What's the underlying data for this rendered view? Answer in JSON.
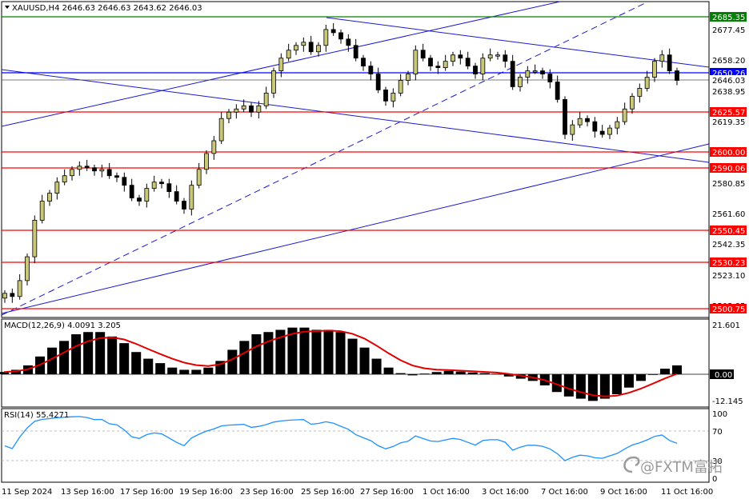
{
  "window": {
    "symbol_header": "XAUUSD,H4  2646.63 2646.63 2643.62 2646.03"
  },
  "colors": {
    "background": "#ffffff",
    "frame": "#000000",
    "bull_candle": "#c8c878",
    "bear_candle": "#000000",
    "support_line": "#ff0000",
    "resistance_line": "#008000",
    "trend_line": "#0000cc",
    "bid_line": "#0000ff",
    "macd_signal": "#e00000",
    "rsi_line": "#1e90ff",
    "watermark": "#9a9a9a"
  },
  "price_axis": {
    "ticks": [
      "2677.45",
      "2658.20",
      "2638.95",
      "2619.35",
      "2580.85",
      "2561.60",
      "2542.35",
      "2523.10",
      "2503.85"
    ],
    "tagged_levels": [
      {
        "value": "2685.35",
        "kind": "resistance"
      },
      {
        "value": "2650.26",
        "kind": "bid"
      },
      {
        "value": "2646.03",
        "kind": "last"
      },
      {
        "value": "2625.57",
        "kind": "support"
      },
      {
        "value": "2600.00",
        "kind": "support"
      },
      {
        "value": "2590.06",
        "kind": "support"
      },
      {
        "value": "2550.45",
        "kind": "support"
      },
      {
        "value": "2530.23",
        "kind": "support"
      },
      {
        "value": "2500.75",
        "kind": "support"
      }
    ]
  },
  "macd": {
    "label": "MACD(12,26,9) 4.0091 3.205",
    "axis_ticks": [
      "21.601",
      "0.00",
      "-12.145"
    ]
  },
  "rsi": {
    "label": "RSI(14) 55.4271",
    "axis_ticks": [
      "100",
      "70",
      "30",
      "0"
    ]
  },
  "time_axis": {
    "labels": [
      "11 Sep 2024",
      "13 Sep 16:00",
      "17 Sep 16:00",
      "19 Sep 16:00",
      "23 Sep 16:00",
      "25 Sep 16:00",
      "27 Sep 16:00",
      "1 Oct 16:00",
      "3 Oct 16:00",
      "7 Oct 16:00",
      "9 Oct 16:00",
      "11 Oct 16:00"
    ]
  },
  "watermark": {
    "text": "@FXTM富拓",
    "icon": "fxtm-swirl-icon"
  },
  "chart_data": {
    "type": "candlestick",
    "symbol": "XAUUSD",
    "timeframe": "H4",
    "last_ohlc": {
      "open": 2646.63,
      "high": 2646.63,
      "low": 2643.62,
      "close": 2646.03
    },
    "ylim": [
      2500,
      2700
    ],
    "horizontal_levels": [
      2685.35,
      2650.26,
      2646.03,
      2625.57,
      2600.0,
      2590.06,
      2550.45,
      2530.23,
      2500.75
    ],
    "close_path": [
      2512,
      2510,
      2520,
      2535,
      2558,
      2570,
      2575,
      2582,
      2586,
      2590,
      2592,
      2591,
      2589,
      2590,
      2586,
      2585,
      2580,
      2572,
      2570,
      2578,
      2582,
      2581,
      2576,
      2570,
      2565,
      2580,
      2590,
      2600,
      2608,
      2622,
      2626,
      2628,
      2630,
      2626,
      2630,
      2638,
      2652,
      2660,
      2665,
      2668,
      2670,
      2664,
      2668,
      2678,
      2676,
      2672,
      2668,
      2660,
      2655,
      2650,
      2640,
      2633,
      2638,
      2646,
      2650,
      2665,
      2660,
      2655,
      2654,
      2658,
      2662,
      2660,
      2655,
      2650,
      2660,
      2662,
      2662,
      2658,
      2642,
      2648,
      2652,
      2652,
      2650,
      2645,
      2634,
      2612,
      2618,
      2622,
      2620,
      2614,
      2612,
      2616,
      2620,
      2628,
      2636,
      2641,
      2648,
      2658,
      2662,
      2652,
      2646
    ],
    "macd": {
      "histogram_approx": [
        1,
        2,
        4,
        8,
        12,
        15,
        18,
        19,
        19,
        17,
        14,
        10,
        7,
        5,
        3,
        2,
        2,
        3,
        6,
        11,
        15,
        18,
        19,
        20,
        21,
        21,
        20,
        20,
        19,
        16,
        12,
        7,
        3,
        0.5,
        -0.5,
        0.3,
        1,
        1.5,
        1.2,
        0.8,
        0.5,
        0.2,
        -1,
        -2,
        -3,
        -5,
        -8,
        -10,
        -11,
        -12,
        -11,
        -9,
        -6,
        -3,
        0,
        2.5,
        4
      ],
      "last_main": 4.0091,
      "last_signal": 3.205
    },
    "rsi": {
      "period": 14,
      "last": 55.4271,
      "levels": [
        70,
        30
      ]
    }
  }
}
